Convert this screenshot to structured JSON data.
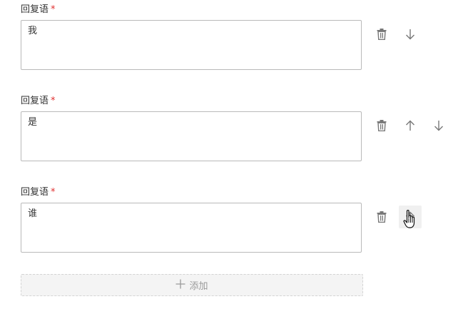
{
  "replies": [
    {
      "label": "回复语",
      "required_mark": "*",
      "value": "我"
    },
    {
      "label": "回复语",
      "required_mark": "*",
      "value": "是"
    },
    {
      "label": "回复语",
      "required_mark": "*",
      "value": "谁"
    }
  ],
  "icons": {
    "delete": "trash-icon",
    "move_up": "arrow-up-icon",
    "move_down": "arrow-down-icon"
  },
  "add_button": {
    "label": "添加",
    "icon": "plus-icon"
  },
  "colors": {
    "required": "#e03030",
    "border": "#b9b9b9",
    "icon": "#777777",
    "add_bg": "#f4f4f4"
  }
}
